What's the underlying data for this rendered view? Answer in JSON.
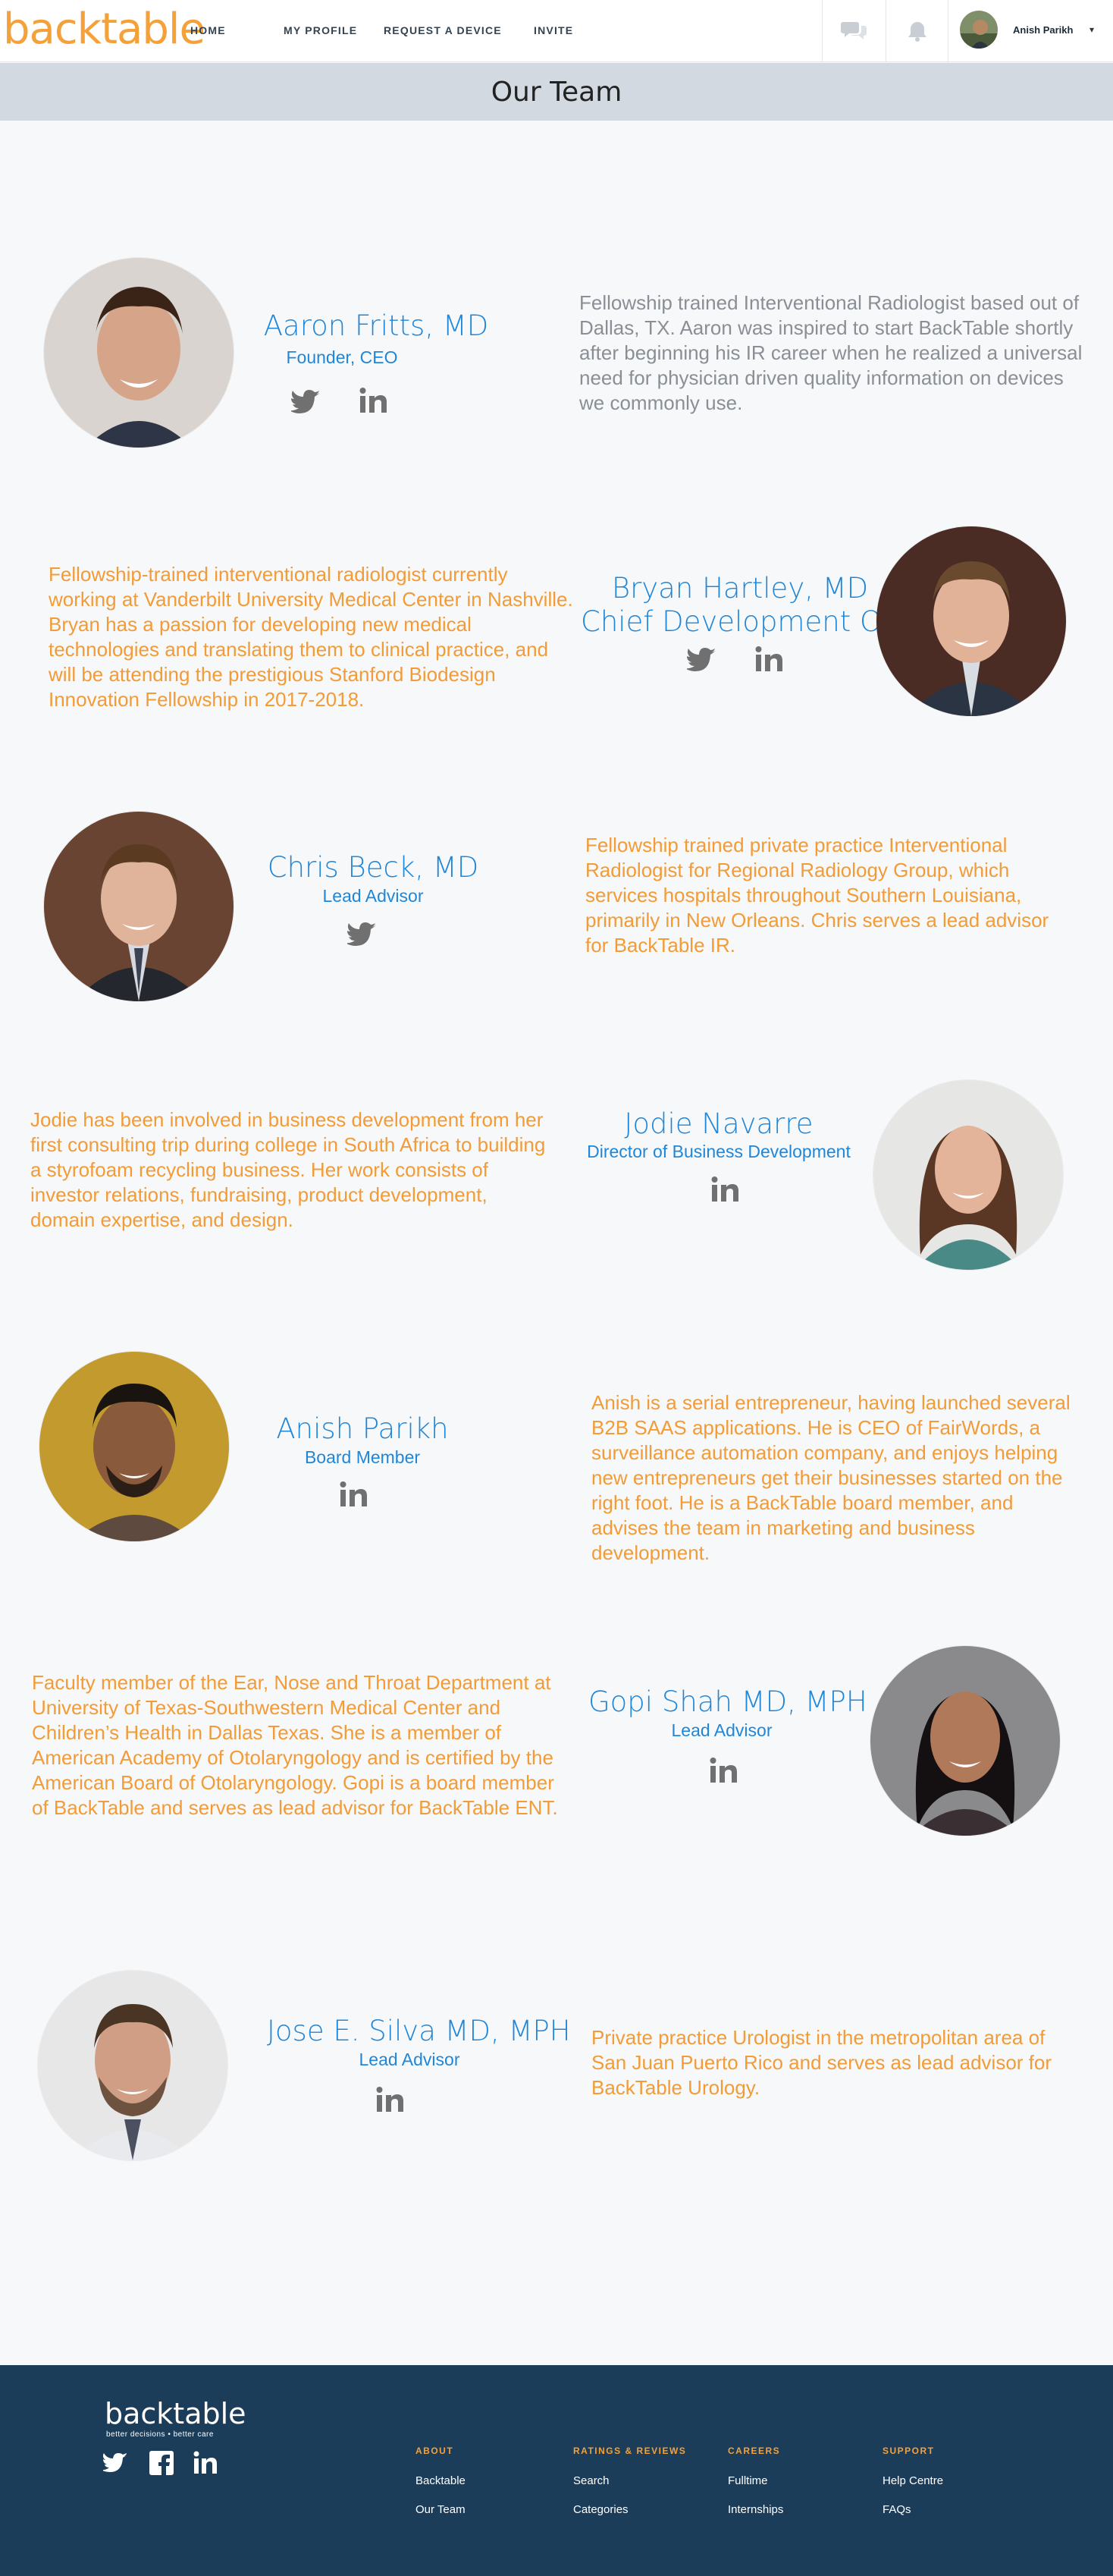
{
  "nav": {
    "logo": "backtable",
    "links": [
      "HOME",
      "MY PROFILE",
      "REQUEST A DEVICE",
      "INVITE"
    ],
    "user_name": "Anish Parikh",
    "caret": "▾",
    "icons": [
      "chat-icon",
      "bell-icon"
    ]
  },
  "banner": {
    "title": "Our Team"
  },
  "team": [
    {
      "name": "Aaron Fritts, MD",
      "role": "Founder, CEO",
      "socials": [
        "twitter-icon",
        "linkedin-icon"
      ],
      "bio": "Fellowship trained Interventional Radiologist based out of Dallas, TX. Aaron was inspired to start BackTable shortly after beginning his IR career when he realized a universal need for physician driven quality information on devices we commonly use."
    },
    {
      "name": "Bryan Hartley, MD",
      "role": "Chief Development Officer",
      "socials": [
        "twitter-icon",
        "linkedin-icon"
      ],
      "bio": "Fellowship-trained interventional radiologist currently working at Vanderbilt University Medical Center in Nashville. Bryan has a passion for developing new medical technologies and translating them to clinical practice, and will be attending the prestigious Stanford Biodesign Innovation Fellowship in 2017-2018."
    },
    {
      "name": "Chris Beck, MD",
      "role": "Lead Advisor",
      "socials": [
        "twitter-icon"
      ],
      "bio": "Fellowship trained private practice Interventional Radiologist for Regional Radiology Group, which services hospitals throughout Southern Louisiana, primarily in New Orleans. Chris serves a lead advisor for BackTable IR."
    },
    {
      "name": "Jodie Navarre",
      "role": "Director of Business Development",
      "socials": [
        "linkedin-icon"
      ],
      "bio": "Jodie has been involved in business development from her first consulting trip during college in South Africa to building a styrofoam recycling business. Her work consists of investor relations, fundraising, product development, domain expertise, and design."
    },
    {
      "name": "Anish Parikh",
      "role": "Board Member",
      "socials": [
        "linkedin-icon"
      ],
      "bio": "Anish is a serial entrepreneur, having launched several B2B SAAS applications.  He is CEO of FairWords, a surveillance automation company, and enjoys helping new entrepreneurs get their businesses started on the right foot.  He is a BackTable board member, and advises the team in marketing and business development."
    },
    {
      "name": "Gopi Shah MD, MPH",
      "role": "Lead Advisor",
      "socials": [
        "linkedin-icon"
      ],
      "bio": "Faculty member of the Ear, Nose and Throat Department at University of Texas-Southwestern Medical Center and Children’s Health in Dallas Texas. She is a member of American Academy of Otolaryngology and is certified by the American Board of Otolaryngology. Gopi is a board member of BackTable and serves as lead advisor for BackTable ENT."
    },
    {
      "name": "Jose E. Silva MD, MPH",
      "role": "Lead Advisor",
      "socials": [
        "linkedin-icon"
      ],
      "bio": "Private practice Urologist in the metropolitan area of San Juan Puerto Rico and serves as lead advisor for BackTable Urology."
    }
  ],
  "footer": {
    "logo": "backtable",
    "tagline": "better decisions • better care",
    "social_icons": [
      "twitter-icon",
      "facebook-icon",
      "linkedin-icon"
    ],
    "columns": [
      {
        "heading": "ABOUT",
        "links": [
          "Backtable",
          "Our Team"
        ]
      },
      {
        "heading": "RATINGS & REVIEWS",
        "links": [
          "Search",
          "Categories"
        ]
      },
      {
        "heading": "CAREERS",
        "links": [
          "Fulltime",
          "Internships"
        ]
      },
      {
        "heading": "SUPPORT",
        "links": [
          "Help Centre",
          "FAQs"
        ]
      }
    ]
  }
}
